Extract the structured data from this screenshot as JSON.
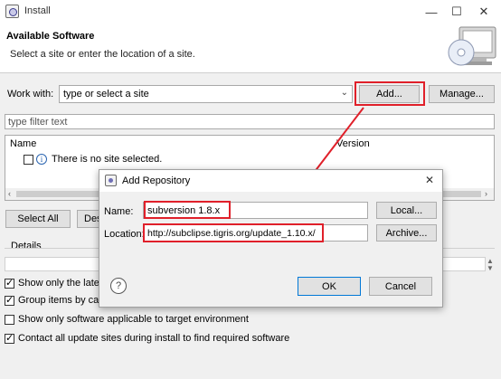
{
  "window": {
    "title": "Install",
    "minimize_glyph": "—",
    "maximize_glyph": "☐",
    "close_glyph": "✕"
  },
  "banner": {
    "heading": "Available Software",
    "subheading": "Select a site or enter the location of a site."
  },
  "work_with": {
    "label": "Work with:",
    "value": "type or select a site",
    "add_button": "Add...",
    "manage_button": "Manage..."
  },
  "filter": {
    "placeholder": "type filter text"
  },
  "table": {
    "columns": [
      "Name",
      "Version"
    ],
    "empty_message": "There is no site selected."
  },
  "buttons": {
    "select_all": "Select All",
    "deselect_all_partial": "Des"
  },
  "details": {
    "label": "Details"
  },
  "options": [
    {
      "label": "Show only the latest",
      "checked": true
    },
    {
      "label": "Group items by cate",
      "checked": true
    },
    {
      "label": "Show only software applicable to target environment",
      "checked": false
    },
    {
      "label": "Contact all update sites during install to find required software",
      "checked": true
    }
  ],
  "dialog": {
    "title": "Add Repository",
    "close_glyph": "✕",
    "name_label": "Name:",
    "name_value": "subversion 1.8.x",
    "local_button": "Local...",
    "location_label": "Location:",
    "location_value": "http://subclipse.tigris.org/update_1.10.x/",
    "archive_button": "Archive...",
    "help_glyph": "?",
    "ok_button": "OK",
    "cancel_button": "Cancel"
  },
  "colors": {
    "annotation_red": "#e0202a",
    "primary_border": "#0078d7"
  },
  "icons": [
    "app-icon",
    "info-icon",
    "help-icon",
    "arrow-annotation",
    "dialog-app-icon"
  ]
}
